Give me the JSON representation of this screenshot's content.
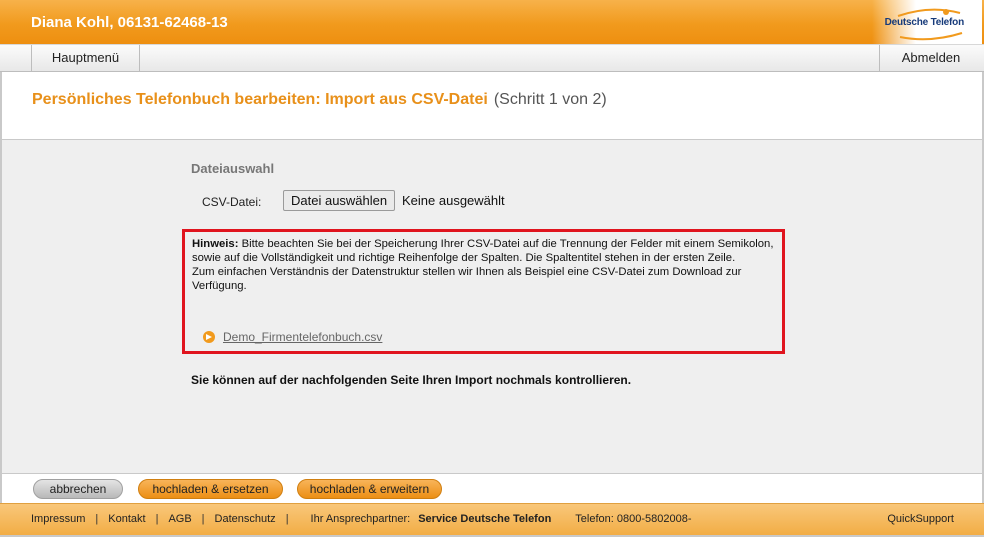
{
  "header": {
    "title": "Diana Kohl, 06131-62468-13",
    "logo_text": "Deutsche Telefon"
  },
  "nav": {
    "home_label": "Hauptmenü",
    "logout_label": "Abmelden"
  },
  "page": {
    "title": "Persönliches Telefonbuch bearbeiten: Import aus CSV-Datei",
    "step": "(Schritt 1 von 2)"
  },
  "content": {
    "section_title": "Dateiauswahl",
    "csv_label": "CSV-Datei:",
    "file_button": "Datei auswählen",
    "file_status": "Keine ausgewählt",
    "hint": {
      "label": "Hinweis:",
      "text1": " Bitte beachten Sie bei der Speicherung Ihrer CSV-Datei auf die Trennung der Felder mit einem Semikolon, sowie auf die Vollständigkeit und richtige Reihenfolge der Spalten. Die Spaltentitel stehen in der ersten Zeile.",
      "text2": "Zum einfachen Verständnis der Datenstruktur stellen wir Ihnen als Beispiel eine CSV-Datei zum Download zur Verfügung.",
      "demo_link": "Demo_Firmentelefonbuch.csv"
    },
    "note": "Sie können auf der nachfolgenden Seite Ihren Import nochmals kontrollieren."
  },
  "buttons": {
    "cancel": "abbrechen",
    "upload_replace": "hochladen & ersetzen",
    "upload_extend": "hochladen & erweitern"
  },
  "footer": {
    "impressum": "Impressum",
    "kontakt": "Kontakt",
    "agb": "AGB",
    "datenschutz": "Datenschutz",
    "separator": "|",
    "partner_label": "Ihr Ansprechpartner:",
    "partner_name": "Service Deutsche Telefon",
    "phone": "Telefon: 0800-5802008-",
    "quicksupport": "QuickSupport"
  },
  "colors": {
    "brand_orange": "#f19a1d",
    "title_orange": "#e8901a",
    "hint_border": "#e0141e",
    "logo_blue": "#163a7a"
  }
}
